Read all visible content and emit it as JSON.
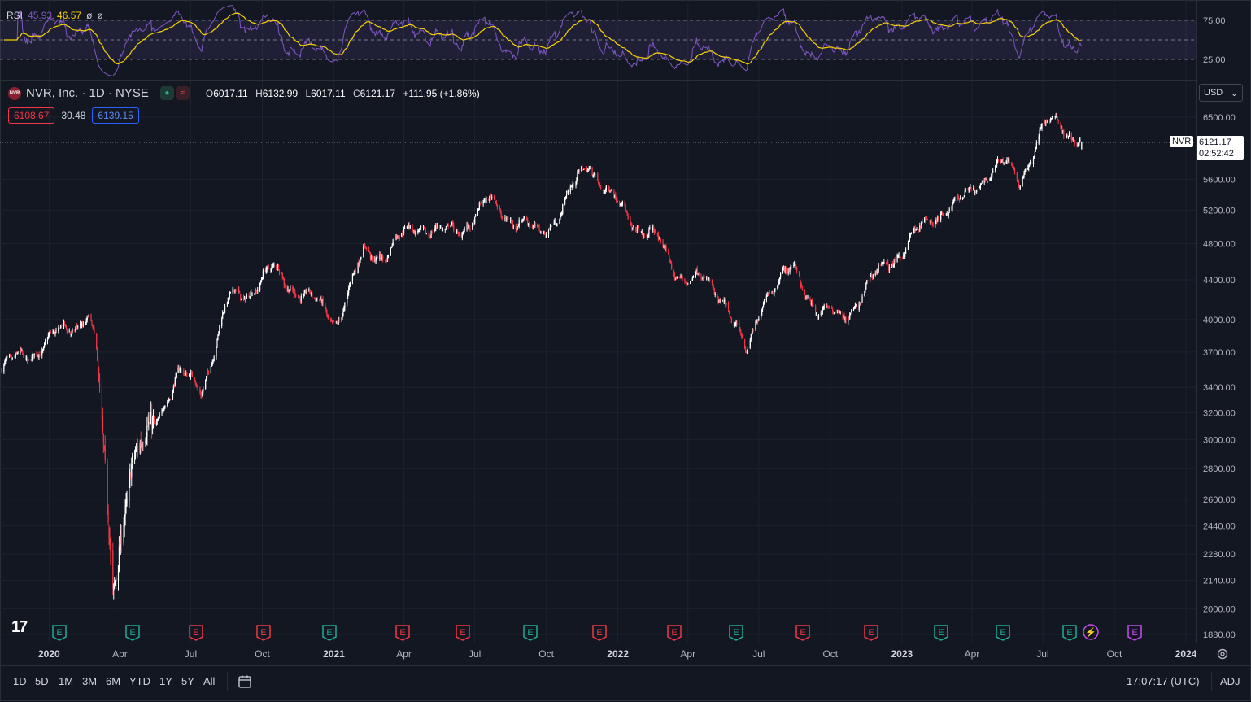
{
  "rsi": {
    "label": "RSI",
    "value1": "45.93",
    "value2": "46.57",
    "extra1": "ø",
    "extra2": "ø",
    "levels": [
      "75.00",
      "25.00"
    ]
  },
  "symbol": {
    "logo_text": "NVR",
    "title": "NVR, Inc. · 1D · NYSE",
    "open_label": "O",
    "open": "6017.11",
    "high_label": "H",
    "high": "6132.99",
    "low_label": "L",
    "low": "6017.11",
    "close_label": "C",
    "close": "6121.17",
    "change": "+111.95 (+1.86%)",
    "market_open_icon": "circle-dot-icon",
    "extended_icon": "wave-icon"
  },
  "quote": {
    "bid": "6108.67",
    "spread": "30.48",
    "ask": "6139.15"
  },
  "currency": "USD",
  "price_axis": {
    "labels": [
      "6500.00",
      "5600.00",
      "5200.00",
      "4800.00",
      "4400.00",
      "4000.00",
      "3700.00",
      "3400.00",
      "3200.00",
      "3000.00",
      "2800.00",
      "2600.00",
      "2440.00",
      "2280.00",
      "2140.00",
      "2000.00",
      "1880.00"
    ],
    "last_symbol": "NVR",
    "last_price": "6121.17",
    "countdown": "02:52:42"
  },
  "time_axis": {
    "labels": [
      "2020",
      "Apr",
      "Jul",
      "Oct",
      "2021",
      "Apr",
      "Jul",
      "Oct",
      "2022",
      "Apr",
      "Jul",
      "Oct",
      "2023",
      "Apr",
      "Jul",
      "Oct",
      "2024"
    ]
  },
  "events": [
    {
      "type": "E",
      "kind": "beat"
    },
    {
      "type": "E",
      "kind": "beat"
    },
    {
      "type": "E",
      "kind": "miss"
    },
    {
      "type": "E",
      "kind": "miss"
    },
    {
      "type": "E",
      "kind": "beat"
    },
    {
      "type": "E",
      "kind": "miss"
    },
    {
      "type": "E",
      "kind": "miss"
    },
    {
      "type": "E",
      "kind": "beat"
    },
    {
      "type": "E",
      "kind": "miss"
    },
    {
      "type": "E",
      "kind": "miss"
    },
    {
      "type": "E",
      "kind": "beat"
    },
    {
      "type": "E",
      "kind": "miss"
    },
    {
      "type": "E",
      "kind": "miss"
    },
    {
      "type": "E",
      "kind": "beat"
    },
    {
      "type": "E",
      "kind": "beat"
    },
    {
      "type": "E",
      "kind": "beat"
    },
    {
      "type": "⚡",
      "kind": "split"
    },
    {
      "type": "E",
      "kind": "upcoming"
    }
  ],
  "bottom_bar": {
    "ranges": [
      "1D",
      "5D",
      "1M",
      "3M",
      "6M",
      "YTD",
      "1Y",
      "5Y",
      "All"
    ],
    "time": "17:07:17 (UTC)",
    "adj": "ADJ"
  },
  "colors": {
    "up": "#ffffff",
    "down": "#f23645",
    "rsi": "#7e57c2",
    "rsi_ma": "#f7d000",
    "bg": "#131722"
  },
  "chart_data": {
    "type": "candlestick",
    "scale": "log",
    "x_range": [
      "2019-11",
      "2024-01"
    ],
    "y_range": [
      1880,
      6500
    ],
    "key_points": [
      {
        "date": "2019-11",
        "close": 3550
      },
      {
        "date": "2020-01",
        "close": 3800
      },
      {
        "date": "2020-02-20",
        "close": 4050
      },
      {
        "date": "2020-03-02",
        "close": 3700
      },
      {
        "date": "2020-03-23",
        "close": 2100
      },
      {
        "date": "2020-04-15",
        "close": 2800
      },
      {
        "date": "2020-05-20",
        "close": 3200
      },
      {
        "date": "2020-06-15",
        "close": 3500
      },
      {
        "date": "2020-07-15",
        "close": 3400
      },
      {
        "date": "2020-08-20",
        "close": 4200
      },
      {
        "date": "2020-09-15",
        "close": 4300
      },
      {
        "date": "2020-10-15",
        "close": 4500
      },
      {
        "date": "2020-12-01",
        "close": 4200
      },
      {
        "date": "2021-01-05",
        "close": 4000
      },
      {
        "date": "2021-02-10",
        "close": 4700
      },
      {
        "date": "2021-03-10",
        "close": 4700
      },
      {
        "date": "2021-04-20",
        "close": 5050
      },
      {
        "date": "2021-05-20",
        "close": 4900
      },
      {
        "date": "2021-06-15",
        "close": 5000
      },
      {
        "date": "2021-07-20",
        "close": 5300
      },
      {
        "date": "2021-08-20",
        "close": 5100
      },
      {
        "date": "2021-09-20",
        "close": 4900
      },
      {
        "date": "2021-10-20",
        "close": 5200
      },
      {
        "date": "2021-11-25",
        "close": 5850
      },
      {
        "date": "2021-12-20",
        "close": 5400
      },
      {
        "date": "2022-01-15",
        "close": 5100
      },
      {
        "date": "2022-02-15",
        "close": 4900
      },
      {
        "date": "2022-03-15",
        "close": 4500
      },
      {
        "date": "2022-04-15",
        "close": 4400
      },
      {
        "date": "2022-05-20",
        "close": 4200
      },
      {
        "date": "2022-06-16",
        "close": 3650
      },
      {
        "date": "2022-07-10",
        "close": 4300
      },
      {
        "date": "2022-08-15",
        "close": 4500
      },
      {
        "date": "2022-09-15",
        "close": 4100
      },
      {
        "date": "2022-10-15",
        "close": 4000
      },
      {
        "date": "2022-11-15",
        "close": 4300
      },
      {
        "date": "2022-12-15",
        "close": 4600
      },
      {
        "date": "2023-01-20",
        "close": 4900
      },
      {
        "date": "2023-02-20",
        "close": 5200
      },
      {
        "date": "2023-03-20",
        "close": 5300
      },
      {
        "date": "2023-04-20",
        "close": 5700
      },
      {
        "date": "2023-05-15",
        "close": 5800
      },
      {
        "date": "2023-06-01",
        "close": 5600
      },
      {
        "date": "2023-07-01",
        "close": 6300
      },
      {
        "date": "2023-07-20",
        "close": 6450
      },
      {
        "date": "2023-08-20",
        "close": 6121.17
      }
    ],
    "rsi_levels": [
      25,
      75
    ]
  }
}
